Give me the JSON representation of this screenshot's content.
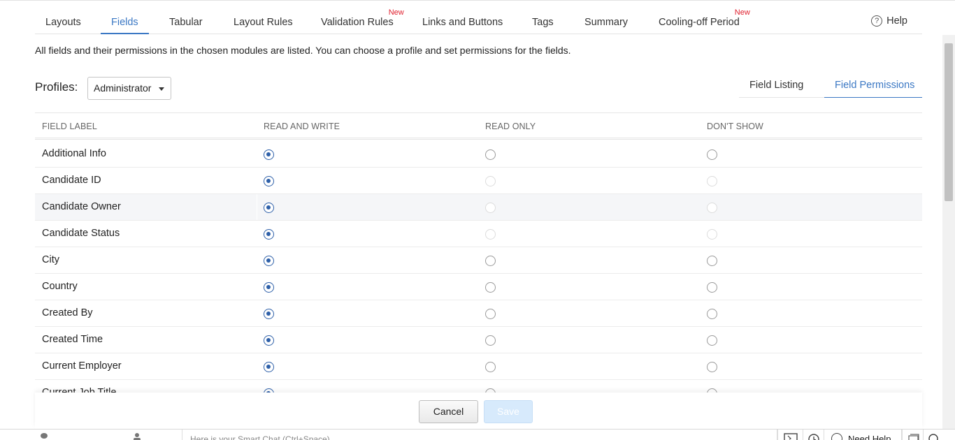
{
  "tabs": [
    {
      "label": "Layouts",
      "new": ""
    },
    {
      "label": "Fields",
      "new": ""
    },
    {
      "label": "Tabular",
      "new": ""
    },
    {
      "label": "Layout Rules",
      "new": ""
    },
    {
      "label": "Validation Rules",
      "new": "New"
    },
    {
      "label": "Links and Buttons",
      "new": ""
    },
    {
      "label": "Tags",
      "new": ""
    },
    {
      "label": "Summary",
      "new": ""
    },
    {
      "label": "Cooling-off Period",
      "new": "New"
    }
  ],
  "active_tab": "Fields",
  "help": {
    "icon": "?",
    "label": "Help"
  },
  "description": "All fields and their permissions in the chosen modules are listed. You can choose a profile and set permissions for the fields.",
  "profiles": {
    "label": "Profiles:",
    "selected": "Administrator"
  },
  "subtabs": {
    "listing": "Field Listing",
    "permissions": "Field Permissions",
    "active": "Field Permissions"
  },
  "table": {
    "headers": [
      "FIELD LABEL",
      "READ AND WRITE",
      "READ ONLY",
      "DON'T SHOW"
    ],
    "rows": [
      {
        "label": "Additional Info",
        "permission": "READ AND WRITE",
        "locked": false
      },
      {
        "label": "Candidate ID",
        "permission": "READ AND WRITE",
        "locked": true
      },
      {
        "label": "Candidate Owner",
        "permission": "READ AND WRITE",
        "locked": true
      },
      {
        "label": "Candidate Status",
        "permission": "READ AND WRITE",
        "locked": true
      },
      {
        "label": "City",
        "permission": "READ AND WRITE",
        "locked": false
      },
      {
        "label": "Country",
        "permission": "READ AND WRITE",
        "locked": false
      },
      {
        "label": "Created By",
        "permission": "READ AND WRITE",
        "locked": false
      },
      {
        "label": "Created Time",
        "permission": "READ AND WRITE",
        "locked": false
      },
      {
        "label": "Current Employer",
        "permission": "READ AND WRITE",
        "locked": false
      },
      {
        "label": "Current Job Title",
        "permission": "READ AND WRITE",
        "locked": false
      }
    ],
    "highlighted_row": "Candidate Owner"
  },
  "buttons": {
    "cancel": "Cancel",
    "save": "Save"
  },
  "bottombar": {
    "chat_placeholder": "Here is your Smart Chat (Ctrl+Space)",
    "need_help": "Need Help"
  },
  "colors": {
    "accent": "#3b78c4",
    "new_badge": "#e0202e",
    "radio_checked": "#2d5fa8",
    "save_disabled": "#d7eafc"
  }
}
